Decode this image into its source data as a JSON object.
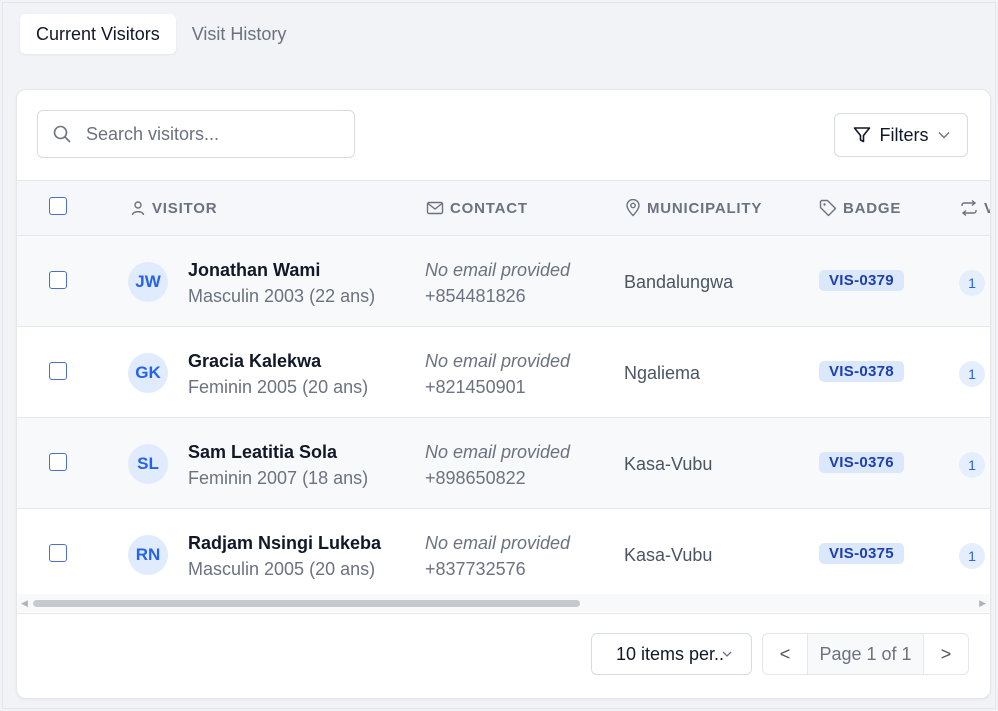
{
  "tabs": [
    {
      "label": "Current Visitors",
      "active": true
    },
    {
      "label": "Visit History",
      "active": false
    }
  ],
  "search": {
    "placeholder": "Search visitors..."
  },
  "filters": {
    "label": "Filters"
  },
  "columns": {
    "visitor": "VISITOR",
    "contact": "CONTACT",
    "municipality": "MUNICIPALITY",
    "badge": "BADGE",
    "visits": "V"
  },
  "rows": [
    {
      "initials": "JW",
      "name": "Jonathan Wami",
      "meta": "Masculin 2003 (22 ans)",
      "email": "No email provided",
      "phone": "+854481826",
      "municipality": "Bandalungwa",
      "badge": "VIS-0379",
      "visits": "1"
    },
    {
      "initials": "GK",
      "name": "Gracia Kalekwa",
      "meta": "Feminin 2005 (20 ans)",
      "email": "No email provided",
      "phone": "+821450901",
      "municipality": "Ngaliema",
      "badge": "VIS-0378",
      "visits": "1"
    },
    {
      "initials": "SL",
      "name": "Sam Leatitia Sola",
      "meta": "Feminin 2007 (18 ans)",
      "email": "No email provided",
      "phone": "+898650822",
      "municipality": "Kasa-Vubu",
      "badge": "VIS-0376",
      "visits": "1"
    },
    {
      "initials": "RN",
      "name": "Radjam Nsingi Lukeba",
      "meta": "Masculin 2005 (20 ans)",
      "email": "No email provided",
      "phone": "+837732576",
      "municipality": "Kasa-Vubu",
      "badge": "VIS-0375",
      "visits": "1"
    }
  ],
  "pagination": {
    "per_page": "10 items per..",
    "prev": "<",
    "page_info": "Page 1 of 1",
    "next": ">"
  },
  "colors": {
    "accent": "#2563eb",
    "badge_bg": "#dbe7fb",
    "badge_text": "#1e40af"
  }
}
